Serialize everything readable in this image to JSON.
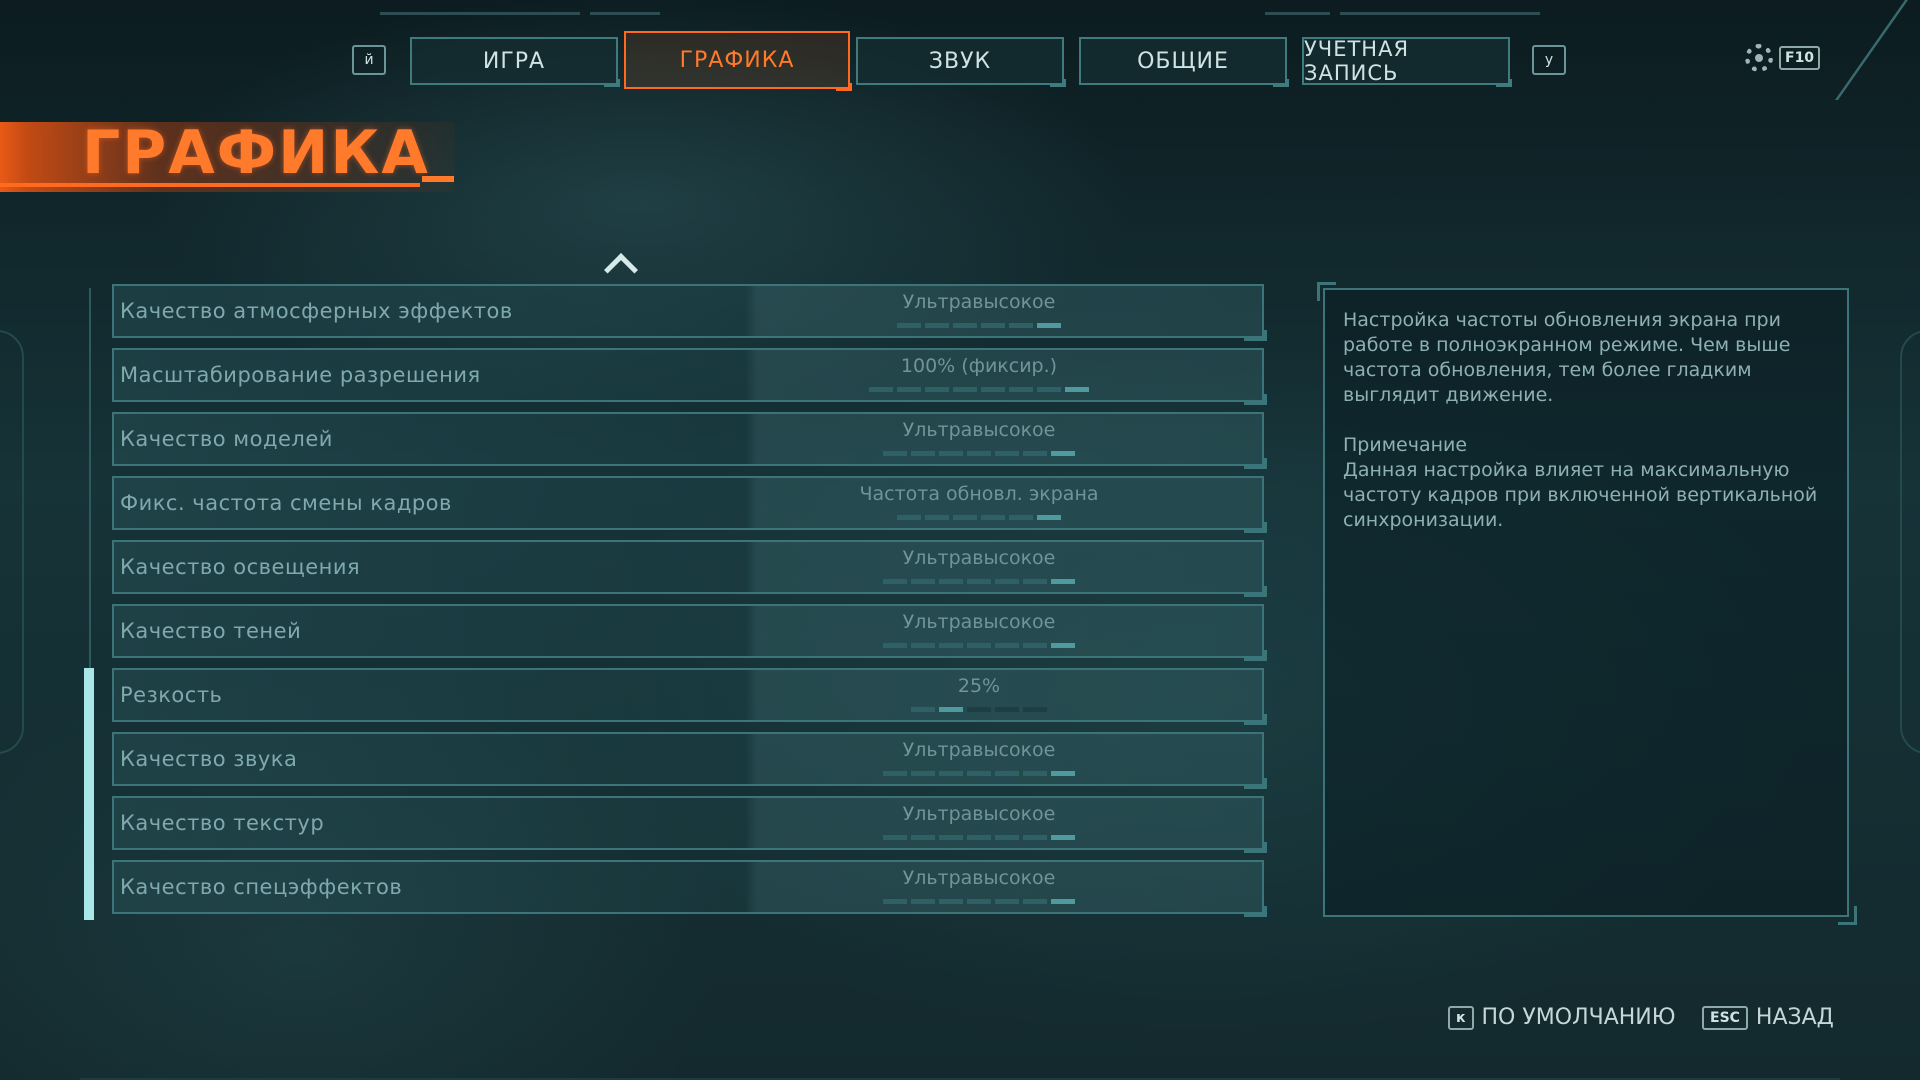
{
  "nav": {
    "prev_key": "й",
    "next_key": "у",
    "tabs": [
      {
        "label": "ИГРА"
      },
      {
        "label": "ГРАФИКА"
      },
      {
        "label": "ЗВУК"
      },
      {
        "label": "ОБЩИЕ"
      },
      {
        "label": "УЧЕТНАЯ ЗАПИСЬ"
      }
    ],
    "active_tab": "ГРАФИКА",
    "settings_key": "F10",
    "settings_icon": "gear-icon"
  },
  "page": {
    "title": "ГРАФИКА"
  },
  "settings": [
    {
      "label": "Качество атмосферных эффектов",
      "value": "Ультравысокое",
      "segments": 6,
      "level": 6
    },
    {
      "label": "Масштабирование разрешения",
      "value": "100% (фиксир.)",
      "segments": 8,
      "level": 8
    },
    {
      "label": "Качество моделей",
      "value": "Ультравысокое",
      "segments": 7,
      "level": 7
    },
    {
      "label": "Фикс. частота смены кадров",
      "value": "Частота обновл. экрана",
      "segments": 6,
      "level": 6
    },
    {
      "label": "Качество освещения",
      "value": "Ультравысокое",
      "segments": 7,
      "level": 7
    },
    {
      "label": "Качество теней",
      "value": "Ультравысокое",
      "segments": 7,
      "level": 7
    },
    {
      "label": "Резкость",
      "value": "25%",
      "segments": 5,
      "level": 2
    },
    {
      "label": "Качество звука",
      "value": "Ультравысокое",
      "segments": 7,
      "level": 7
    },
    {
      "label": "Качество текстур",
      "value": "Ультравысокое",
      "segments": 7,
      "level": 7
    },
    {
      "label": "Качество спецэффектов",
      "value": "Ультравысокое",
      "segments": 7,
      "level": 7
    }
  ],
  "info": {
    "description": "Настройка частоты обновления экрана при работе в полноэкранном режиме. Чем выше частота обновления, тем более гладким выглядит движение.",
    "note_title": "Примечание",
    "note_text": "Данная настройка влияет на максимальную частоту кадров при включенной вертикальной синхронизации."
  },
  "footer": {
    "default_key": "к",
    "default_label": "ПО УМОЛЧАНИЮ",
    "back_key": "ESC",
    "back_label": "НАЗАД"
  },
  "colors": {
    "accent": "#ff6a1f",
    "frame": "#3b7579",
    "text": "#7fa9ad"
  }
}
